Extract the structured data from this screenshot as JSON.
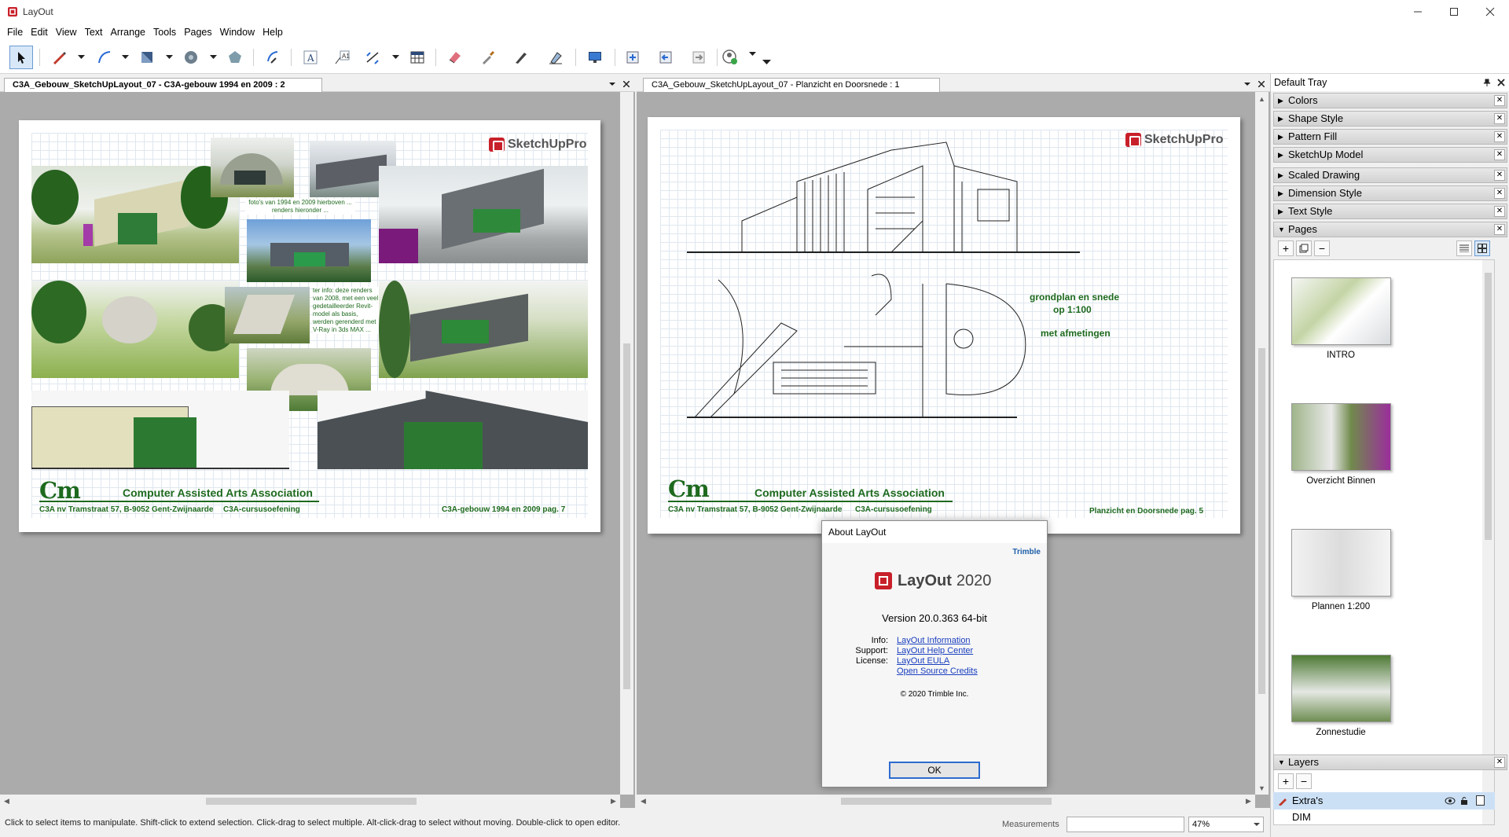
{
  "window": {
    "title": "LayOut"
  },
  "menu": [
    "File",
    "Edit",
    "View",
    "Text",
    "Arrange",
    "Tools",
    "Pages",
    "Window",
    "Help"
  ],
  "tabs": {
    "left": "C3A_Gebouw_SketchUpLayout_07 - C3A-gebouw 1994 en 2009 : 2",
    "right": "C3A_Gebouw_SketchUpLayout_07 - Planzicht en Doorsnede : 1"
  },
  "pages": {
    "left": {
      "logo": "SketchUpPro",
      "caption_top": "foto's van 1994 en 2009 hierboven ... renders hieronder ...",
      "caption_mid": "ter info: deze renders van 2008, met een veel gedetailleerder Revit-model als basis, werden gerenderd met V-Ray in 3ds MAX ...",
      "brand_mark": "Cm",
      "brand_name": "Computer Assisted Arts Association",
      "address": "C3A nv  Tramstraat 57, B-9052 Gent-Zwijnaarde",
      "course": "C3A-cursusoefening",
      "page_label": "C3A-gebouw 1994 en 2009   pag.  7"
    },
    "right": {
      "logo": "SketchUpPro",
      "note1": "grondplan en snede",
      "note2": "op 1:100",
      "note3": "met afmetingen",
      "brand_mark": "Cm",
      "brand_name": "Computer Assisted Arts Association",
      "address": "C3A nv  Tramstraat 57, B-9052 Gent-Zwijnaarde",
      "course": "C3A-cursusoefening",
      "page_label": "Planzicht en Doorsnede   pag.  5"
    }
  },
  "status": {
    "hint": "Click to select items to manipulate. Shift-click to extend selection. Click-drag to select multiple. Alt-click-drag to select without moving. Double-click to open editor.",
    "measurements_label": "Measurements",
    "measurements_value": "",
    "zoom": "47%"
  },
  "tray": {
    "title": "Default Tray",
    "sections": [
      "Colors",
      "Shape Style",
      "Pattern Fill",
      "SketchUp Model",
      "Scaled Drawing",
      "Dimension Style",
      "Text Style",
      "Pages"
    ],
    "pages_list": [
      "INTRO",
      "Overzicht Binnen",
      "Plannen 1:200",
      "Zonnestudie"
    ],
    "layers_title": "Layers",
    "layers": [
      "Extra's",
      "DIM"
    ]
  },
  "about": {
    "title": "About LayOut",
    "vendor": "Trimble",
    "product": "LayOut",
    "year": "2020",
    "version": "Version 20.0.363 64-bit",
    "info_label": "Info:",
    "info_link": "LayOut Information",
    "support_label": "Support:",
    "support_link": "LayOut Help Center",
    "license_label": "License:",
    "license_link": "LayOut EULA",
    "oss_link": "Open Source Credits",
    "copyright": "© 2020 Trimble Inc.",
    "ok": "OK"
  }
}
